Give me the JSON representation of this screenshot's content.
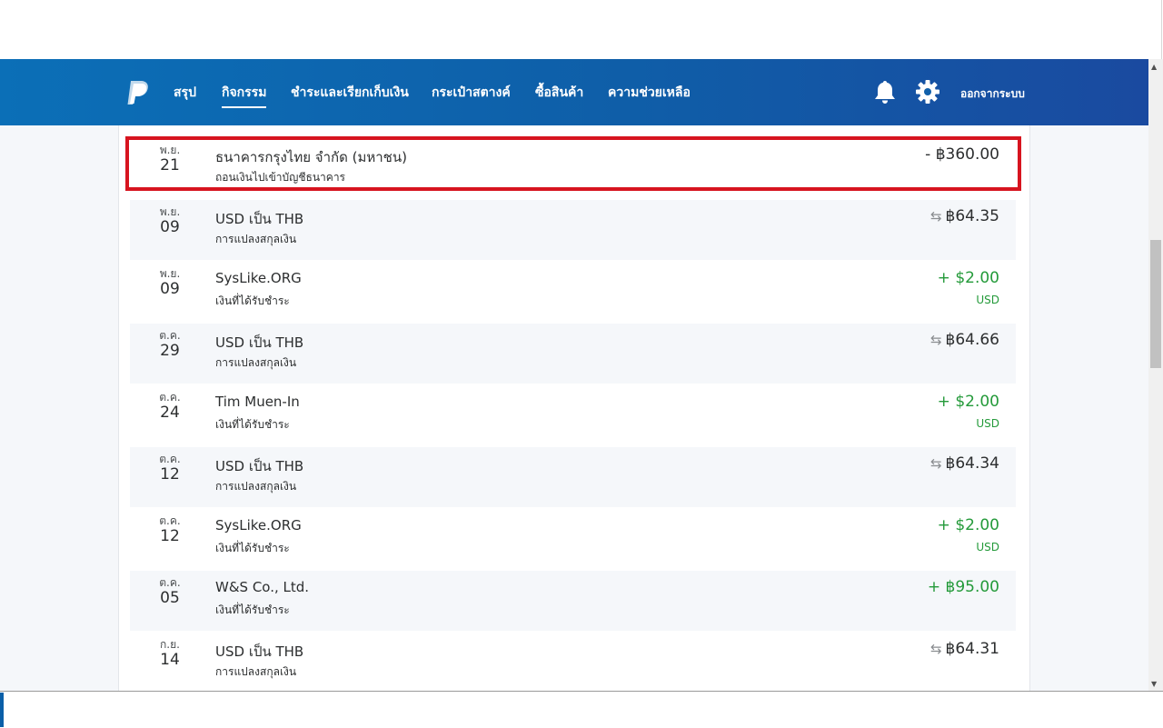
{
  "nav": {
    "links": [
      "สรุป",
      "กิจกรรม",
      "ชำระและเรียกเก็บเงิน",
      "กระเป๋าสตางค์",
      "ซื้อสินค้า",
      "ความช่วยเหลือ"
    ],
    "active": "กิจกรรม",
    "logout": "ออกจากระบบ",
    "icons": {
      "logo": "paypal-logo",
      "bell": "bell-icon",
      "settings": "gear-icon"
    },
    "colors": {
      "bar_start": "#0b6fb7",
      "bar_end": "#1a4aa0"
    }
  },
  "activity": {
    "rows": [
      {
        "month": "พ.ย.",
        "day": "21",
        "name": "ธนาคารกรุงไทย จำกัด (มหาชน)",
        "type": "ถอนเงินไปเข้าบัญชีธนาคาร",
        "amount": "- ฿360.00",
        "currency": "",
        "kind": "debit",
        "highlighted": true
      },
      {
        "month": "พ.ย.",
        "day": "09",
        "name": "USD เป็น THB",
        "type": "การแปลงสกุลเงิน",
        "amount": "฿64.35",
        "currency": "",
        "kind": "conversion"
      },
      {
        "month": "พ.ย.",
        "day": "09",
        "name": "SysLike.ORG",
        "type": "เงินที่ได้รับชำระ",
        "amount": "+ $2.00",
        "currency": "USD",
        "kind": "credit"
      },
      {
        "month": "ต.ค.",
        "day": "29",
        "name": "USD เป็น THB",
        "type": "การแปลงสกุลเงิน",
        "amount": "฿64.66",
        "currency": "",
        "kind": "conversion"
      },
      {
        "month": "ต.ค.",
        "day": "24",
        "name": "Tim Muen-In",
        "type": "เงินที่ได้รับชำระ",
        "amount": "+ $2.00",
        "currency": "USD",
        "kind": "credit"
      },
      {
        "month": "ต.ค.",
        "day": "12",
        "name": "USD เป็น THB",
        "type": "การแปลงสกุลเงิน",
        "amount": "฿64.34",
        "currency": "",
        "kind": "conversion"
      },
      {
        "month": "ต.ค.",
        "day": "12",
        "name": "SysLike.ORG",
        "type": "เงินที่ได้รับชำระ",
        "amount": "+ $2.00",
        "currency": "USD",
        "kind": "credit"
      },
      {
        "month": "ต.ค.",
        "day": "05",
        "name": "W&S Co., Ltd.",
        "type": "เงินที่ได้รับชำระ",
        "amount": "+ ฿95.00",
        "currency": "",
        "kind": "credit"
      },
      {
        "month": "ก.ย.",
        "day": "14",
        "name": "USD เป็น THB",
        "type": "การแปลงสกุลเงิน",
        "amount": "฿64.31",
        "currency": "",
        "kind": "conversion"
      }
    ],
    "colors": {
      "credit": "#249a3a",
      "highlight_border": "#d7141f"
    }
  }
}
